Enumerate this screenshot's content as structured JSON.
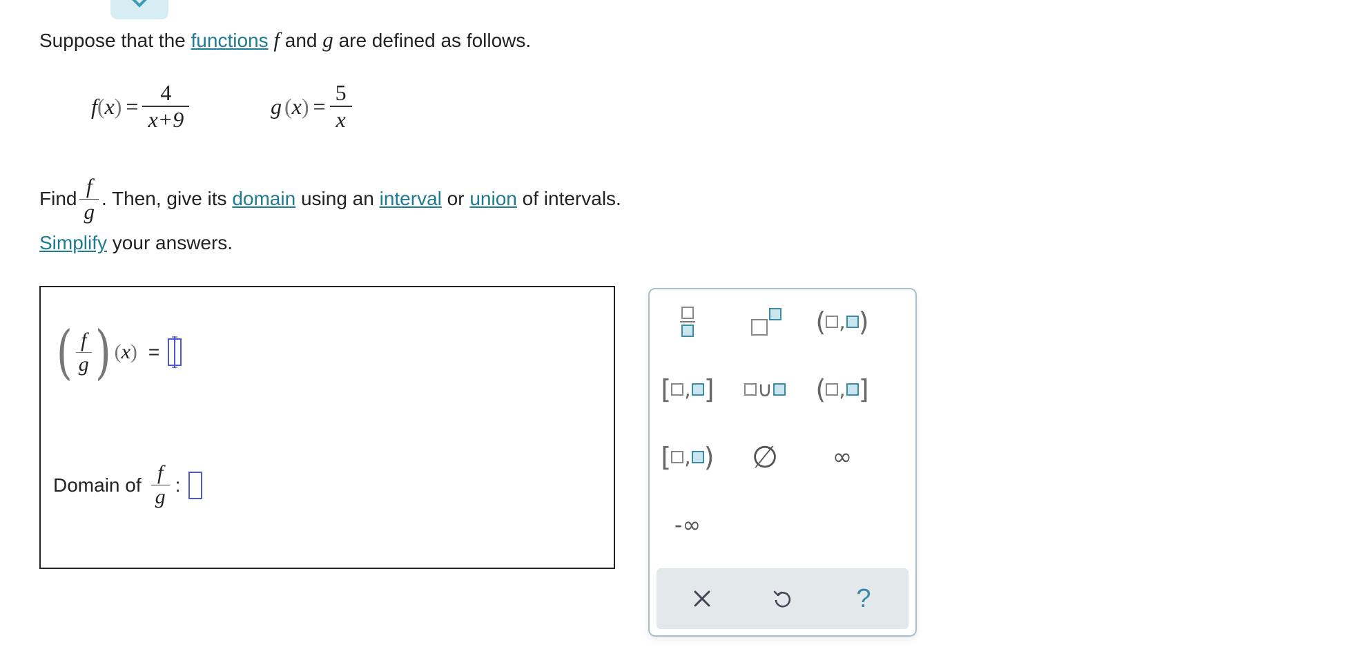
{
  "problem": {
    "intro_before": "Suppose that the",
    "intro_link": "functions",
    "intro_f": "f",
    "intro_and": "and",
    "intro_g": "g",
    "intro_after": "are defined as follows.",
    "f_def": {
      "name": "f",
      "var": "x",
      "numerator": "4",
      "denominator": "x+9"
    },
    "g_def": {
      "name": "g",
      "var": "x",
      "numerator": "5",
      "denominator": "x"
    },
    "find_word": "Find",
    "find_frac": {
      "num": "f",
      "den": "g"
    },
    "find_then": ". Then, give its",
    "link_domain": "domain",
    "using_an": "using an",
    "link_interval": "interval",
    "or": "or",
    "link_union": "union",
    "of_intervals": "of intervals.",
    "link_simplify": "Simplify",
    "your_answers": "your answers."
  },
  "answer": {
    "expr_num": "f",
    "expr_den": "g",
    "expr_var": "x",
    "equals": "=",
    "domain_label": "Domain of",
    "domain_num": "f",
    "domain_den": "g",
    "domain_colon": ":"
  },
  "palette": {
    "buttons": [
      "fraction",
      "superscript",
      "open-interval",
      "closed-interval",
      "union",
      "half-open-right-closed",
      "half-open-left-closed",
      "empty-set",
      "infinity",
      "negative-infinity"
    ],
    "comma": ",",
    "union_symbol": "∪",
    "empty_set": "∅",
    "infinity": "∞",
    "neg_infinity": "-∞",
    "actions": {
      "clear": "×",
      "undo": "↺",
      "help": "?"
    }
  }
}
